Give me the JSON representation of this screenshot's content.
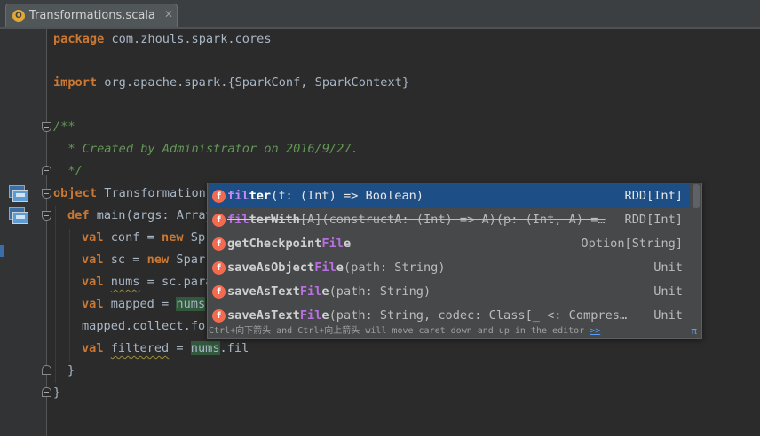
{
  "tab": {
    "icon_letter": "O",
    "title": "Transformations.scala",
    "close": "✕"
  },
  "code": {
    "l1_kw": "package",
    "l1_rest": " com.zhouls.spark.cores",
    "l2_kw": "import",
    "l2_rest": " org.apache.spark.{SparkConf, SparkContext}",
    "l3": "/**",
    "l4": "  * Created by Administrator on 2016/9/27.",
    "l5": "  */",
    "l6_kw": "object",
    "l6_rest": " Transformation",
    "l7_kw": "def",
    "l7_rest": " main(args: Array",
    "l8_kw1": "val",
    "l8_mid": " conf = ",
    "l8_kw2": "new",
    "l8_rest": " Sp",
    "l9_kw1": "val",
    "l9_mid": " sc = ",
    "l9_kw2": "new",
    "l9_rest": " Spar",
    "l10_kw": "val",
    "l10_sp": " ",
    "l10_var": "nums",
    "l10_rest": " = sc.para",
    "l11_kw": "val",
    "l11_mid": " mapped = ",
    "l11_var": "nums",
    "l11_rest": ".",
    "l12": "mapped.collect.for",
    "l13_kw": "val",
    "l13_sp": " ",
    "l13_var": "filtered",
    "l13_mid": " = ",
    "l13_var2": "nums",
    "l13_rest": ".fil",
    "l14": "}",
    "l15": "}"
  },
  "completion": {
    "items": [
      {
        "name_match": "fil",
        "name_rest": "ter",
        "sig": "(f: (Int) => Boolean)",
        "type": "RDD[Int]",
        "icon": "f"
      },
      {
        "name_match": "fil",
        "name_rest": "terWith",
        "sig": "[A](constructA: (Int) => A)(p: (Int, A) =…",
        "type": "RDD[Int]",
        "icon": "f"
      },
      {
        "name_pre": "getCheckpoint",
        "name_match": "Fil",
        "name_rest": "e",
        "sig": "",
        "type": "Option[String]",
        "icon": "f"
      },
      {
        "name_pre": "saveAsObject",
        "name_match": "Fil",
        "name_rest": "e",
        "sig": "(path: String)",
        "type": "Unit",
        "icon": "f"
      },
      {
        "name_pre": "saveAsText",
        "name_match": "Fil",
        "name_rest": "e",
        "sig": "(path: String)",
        "type": "Unit",
        "icon": "f"
      },
      {
        "name_pre": "saveAsText",
        "name_match": "Fil",
        "name_rest": "e",
        "sig": "(path: String, codec: Class[_ <: Compres…",
        "type": "Unit",
        "icon": "f"
      }
    ],
    "hint": "Ctrl+向下箭头 and Ctrl+向上箭头 will move caret down and up in the editor",
    "hint_link": ">>",
    "pi": "π"
  },
  "colors": {
    "background": "#2b2b2b",
    "keyword": "#cc7832",
    "comment": "#629755",
    "selection": "#1d4f86",
    "match": "#b86fe0"
  }
}
